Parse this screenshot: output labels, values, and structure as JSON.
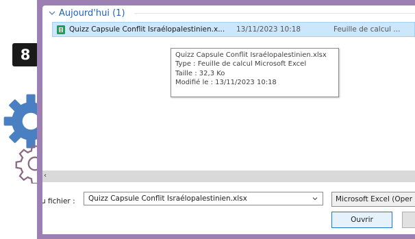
{
  "step": {
    "number": "8"
  },
  "explorer": {
    "group": {
      "title": "Aujourd'hui (1)"
    },
    "file": {
      "name": "Quizz Capsule Conflit Israélopalestinien.x...",
      "modified": "13/11/2023 10:18",
      "type": "Feuille de calcul ..."
    },
    "tooltip": {
      "line1": "Quizz Capsule Conflit Israélopalestinien.xlsx",
      "line2": "Type : Feuille de calcul Microsoft Excel",
      "line3": "Taille : 32,3 Ko",
      "line4": "Modifié le : 13/11/2023 10:18"
    },
    "scroll_arrow": "‹"
  },
  "footer": {
    "filename_label": "u fichier :",
    "filename_value": "Quizz Capsule Conflit Israélopalestinien.xlsx",
    "filetype_value": "Microsoft Excel (Oper",
    "open_label": "Ouvrir",
    "cancel_label": ""
  },
  "colors": {
    "frame": "#9c7fb3",
    "accent_blue": "#1e63b8",
    "selection": "#cce6fb",
    "gear_blue": "#4a7fc1",
    "badge": "#1a1a1a"
  },
  "icons": [
    "chevron-down-icon",
    "excel-file-icon",
    "gear-icon",
    "gear-outline-icon",
    "step-badge"
  ]
}
